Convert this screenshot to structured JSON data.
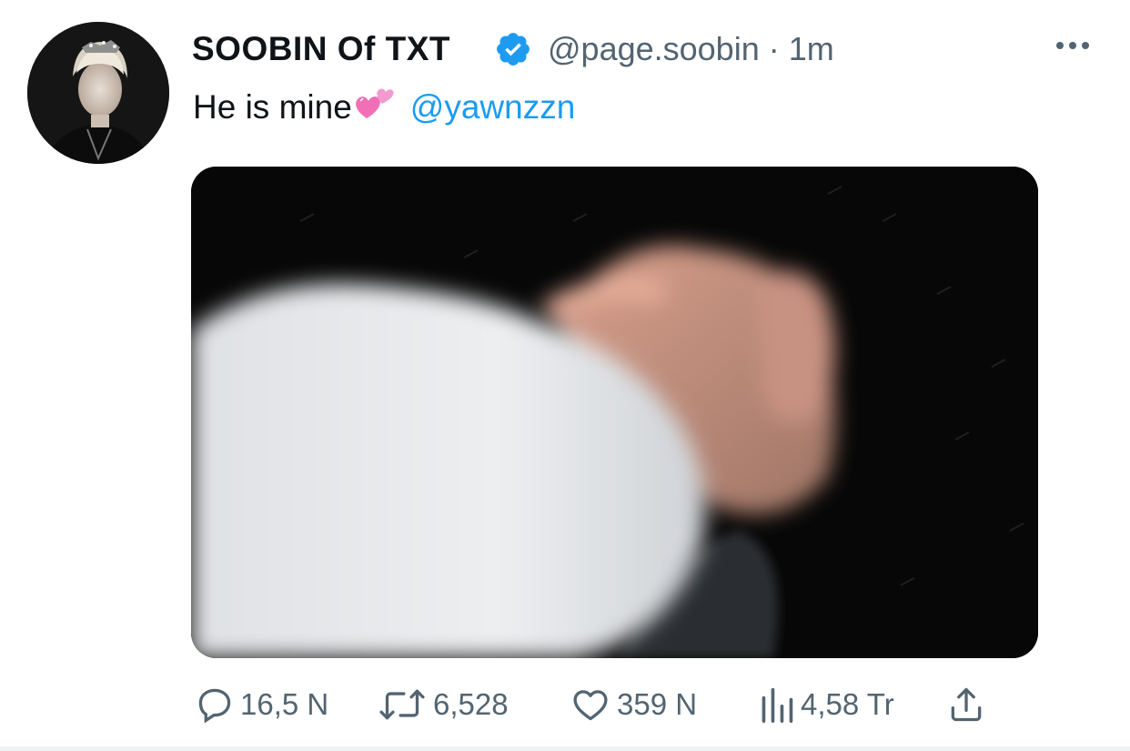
{
  "tweet": {
    "author": {
      "display_name": "SOOBIN Of TXT",
      "verified": true,
      "handle": "@page.soobin",
      "separator": "·",
      "time": "1m"
    },
    "text": "He is mine",
    "emoji": "two-hearts-emoji",
    "mention": "@yawnzzn",
    "media": {
      "type": "photo"
    },
    "actions": {
      "replies": "16,5 N",
      "retweets": "6,528",
      "likes": "359 N",
      "views": "4,58 Tr"
    }
  },
  "colors": {
    "accent": "#1d9bf0",
    "text_primary": "#0f1419",
    "text_secondary": "#536471",
    "background": "#ffffff"
  },
  "icons": [
    "verified-badge-icon",
    "more-options-icon",
    "reply-icon",
    "retweet-icon",
    "like-icon",
    "views-icon",
    "share-icon"
  ]
}
